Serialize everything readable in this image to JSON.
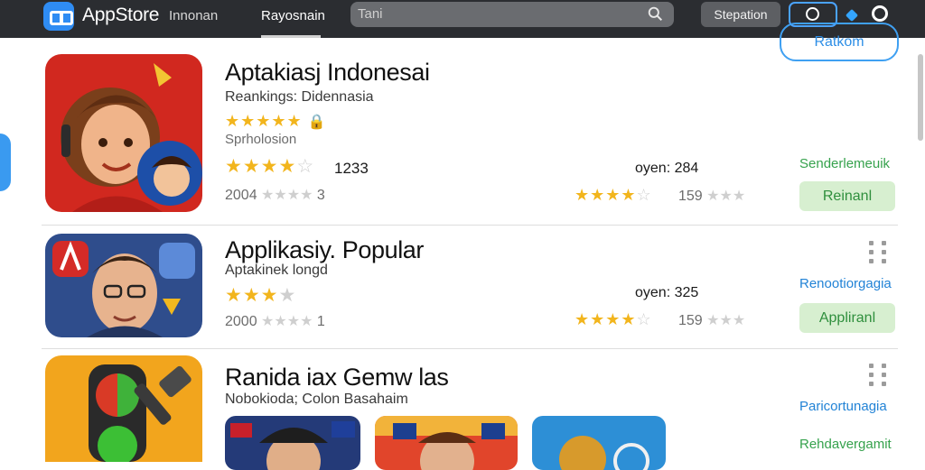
{
  "header": {
    "brand": "AppStore",
    "nav": [
      "Innonan",
      "Rayosnain"
    ],
    "search_placeholder": "Tani",
    "button": "Stepation"
  },
  "apps": [
    {
      "title": "Aptakiasj Indonesai",
      "subtitle": "Reankings: Didennasia",
      "category": "Sprholosion",
      "rating_count": "1233",
      "secondary_count_label": "oyen: 284",
      "meta_left": "2004",
      "meta_right": "159",
      "action_top": "Ratkom",
      "link": "Senderlemeuik",
      "action_bottom": "Reinanl"
    },
    {
      "title": "Applikasiy. Popular",
      "subtitle": "Aptakinek longd",
      "meta_left": "2000",
      "meta_left_num": "1",
      "secondary_count_label": "oyen: 325",
      "meta_right": "159",
      "link": "Renootiorgagia",
      "action": "Appliranl"
    },
    {
      "title": "Ranida iax Gemw las",
      "subtitle": "Nobokioda; Colon Basahaim",
      "link_blue": "Paricortunagia",
      "link_green": "Rehdavergamit"
    }
  ],
  "colors": {
    "topbar": "#2b2d31",
    "accent_blue": "#3fa0f2",
    "star": "#f2b51d",
    "green": "#36a24d"
  }
}
